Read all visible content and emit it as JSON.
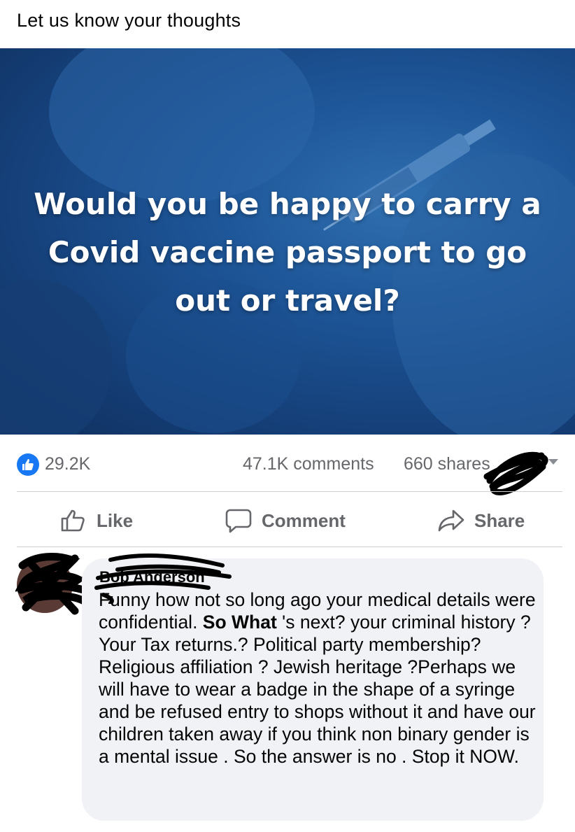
{
  "post": {
    "text": "Let us know your thoughts",
    "image": {
      "headline_lines": [
        "Would you be happy to carry a",
        "Covid vaccine passport to go",
        "out or travel?"
      ]
    }
  },
  "stats": {
    "reactions": "29.2K",
    "comments": "47.1K comments",
    "shares": "660 shares"
  },
  "actions": {
    "like": "Like",
    "comment": "Comment",
    "share": "Share"
  },
  "comment": {
    "author": "Bob Anderson",
    "text_before_bold": "Funny how not so long ago your medical details were confidential. ",
    "bold": "So What",
    "text_after_bold": " 's next? your criminal history ? Your Tax returns.? Political party membership? Religious affiliation ? Jewish heritage ?Perhaps we will have to wear a badge in the shape of a syringe and be refused entry to shops without it and have our children taken away if you think non binary gender is a mental issue . So the answer is no . Stop it NOW."
  },
  "colors": {
    "brand_blue": "#1877f2",
    "muted_text": "#65676b",
    "bubble_bg": "#f0f2f5",
    "image_blue": "#1d5597"
  },
  "icons": [
    "like-reaction-icon",
    "thumbs-up-icon",
    "comment-icon",
    "share-arrow-icon",
    "options-caret-icon"
  ]
}
